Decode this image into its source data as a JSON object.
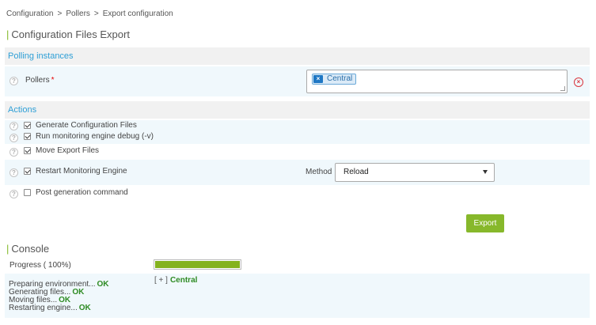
{
  "breadcrumb": [
    "Configuration",
    "Pollers",
    "Export configuration"
  ],
  "breadcrumb_separator": ">",
  "page_title": "Configuration Files Export",
  "title_marker": "|",
  "polling_section": {
    "header": "Polling instances",
    "pollers_label": "Pollers",
    "required_mark": "*",
    "selected": [
      "Central"
    ]
  },
  "actions_section": {
    "header": "Actions",
    "options": [
      {
        "label": "Generate Configuration Files",
        "checked": true
      },
      {
        "label": "Run monitoring engine debug (-v)",
        "checked": true
      },
      {
        "label": "Move Export Files",
        "checked": true
      },
      {
        "label": "Restart Monitoring Engine",
        "checked": true
      },
      {
        "label": "Post generation command",
        "checked": false
      }
    ],
    "method_label": "Method",
    "method_value": "Reload"
  },
  "export_label": "Export",
  "console": {
    "title": "Console",
    "progress_label": "Progress ( 100%)",
    "progress_value": 100,
    "steps": [
      {
        "text": "Preparing environment...",
        "status": "OK"
      },
      {
        "text": "Generating files...",
        "status": "OK"
      },
      {
        "text": "Moving files...",
        "status": "OK"
      },
      {
        "text": "Restarting engine...",
        "status": "OK"
      }
    ],
    "poller_toggle": "[ + ]",
    "poller_name": "Central"
  },
  "icons": {
    "help": "help-icon",
    "remove_chip": "close-icon",
    "clear_selection": "clear-icon",
    "dropdown": "chevron-down-icon"
  },
  "colors": {
    "accent_blue": "#2e9fd6",
    "accent_green": "#84ba2a",
    "ok_green": "#2e8b23",
    "required_red": "#e60000"
  }
}
